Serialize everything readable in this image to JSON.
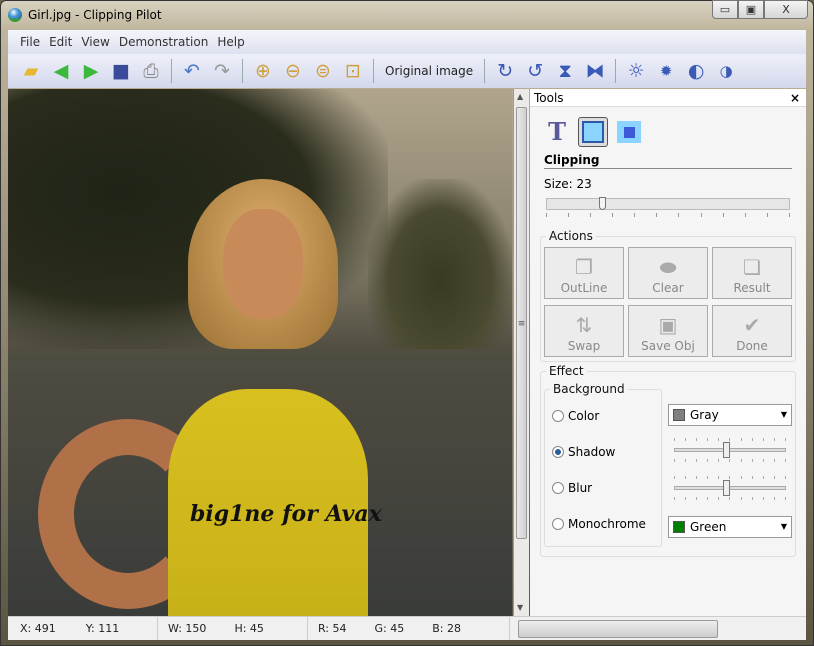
{
  "window": {
    "title": "Girl.jpg - Clipping Pilot",
    "min": "▭",
    "max": "▣",
    "close": "X"
  },
  "menu": [
    "File",
    "Edit",
    "View",
    "Demonstration",
    "Help"
  ],
  "toolbar": {
    "original_image": "Original image"
  },
  "image": {
    "watermark": "big1ne for Avax"
  },
  "tools": {
    "title": "Tools",
    "close": "×",
    "section": "Clipping",
    "size_label": "Size: 23",
    "size_value": 23,
    "actions_legend": "Actions",
    "actions": [
      {
        "label": "OutLine"
      },
      {
        "label": "Clear"
      },
      {
        "label": "Result"
      },
      {
        "label": "Swap"
      },
      {
        "label": "Save Obj"
      },
      {
        "label": "Done"
      }
    ],
    "effect_legend": "Effect",
    "background_legend": "Background",
    "options": [
      {
        "label": "Color",
        "selected": false
      },
      {
        "label": "Shadow",
        "selected": true
      },
      {
        "label": "Blur",
        "selected": false
      },
      {
        "label": "Monochrome",
        "selected": false
      }
    ],
    "color_select": {
      "value": "Gray",
      "swatch": "#808080"
    },
    "mono_select": {
      "value": "Green",
      "swatch": "#008000"
    }
  },
  "status": {
    "x": "X: 491",
    "y": "Y: 111",
    "w": "W: 150",
    "h": "H: 45",
    "r": "R: 54",
    "g": "G: 45",
    "b": "B: 28"
  }
}
